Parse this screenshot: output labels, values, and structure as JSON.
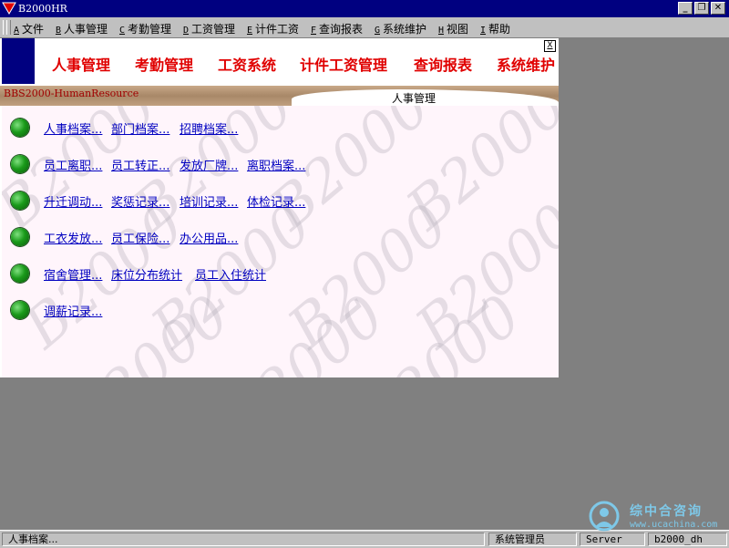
{
  "window": {
    "title": "B2000HR"
  },
  "menubar": {
    "items": [
      {
        "key": "A",
        "label": "文件"
      },
      {
        "key": "B",
        "label": "人事管理"
      },
      {
        "key": "C",
        "label": "考勤管理"
      },
      {
        "key": "D",
        "label": "工资管理"
      },
      {
        "key": "E",
        "label": "计件工资"
      },
      {
        "key": "F",
        "label": "查询报表"
      },
      {
        "key": "G",
        "label": "系统维护"
      },
      {
        "key": "H",
        "label": "视图"
      },
      {
        "key": "I",
        "label": "帮助"
      }
    ]
  },
  "child": {
    "close_label": "X",
    "nav_tabs": [
      "人事管理",
      "考勤管理",
      "工资系统",
      "计件工资管理",
      "查询报表",
      "系统维护"
    ],
    "strip_left": "BBS2000-HumanResource",
    "strip_right": "人事管理",
    "watermark": "B2000",
    "rows": [
      [
        "人事档案...",
        "部门档案...",
        "招聘档案..."
      ],
      [
        "员工离职...",
        "员工转正...",
        "发放厂牌...",
        "离职档案..."
      ],
      [
        "升迁调动...",
        "奖惩记录...",
        "培训记录...",
        "体检记录..."
      ],
      [
        "工衣发放...",
        "员工保险...",
        "办公用品..."
      ],
      [
        "宿舍管理...",
        "床位分布统计",
        "员工入住统计"
      ],
      [
        "调薪记录..."
      ]
    ]
  },
  "statusbar": {
    "message": "人事档案...",
    "user": "系统管理员",
    "server": "Server",
    "database": "b2000_dh"
  },
  "corner_logo": {
    "text": "综中合咨询",
    "url": "www.ucachina.com"
  },
  "colors": {
    "titlebar": "#000080",
    "nav": "#e00000",
    "link": "#0000c0",
    "bullet": "#1a9a1a"
  }
}
